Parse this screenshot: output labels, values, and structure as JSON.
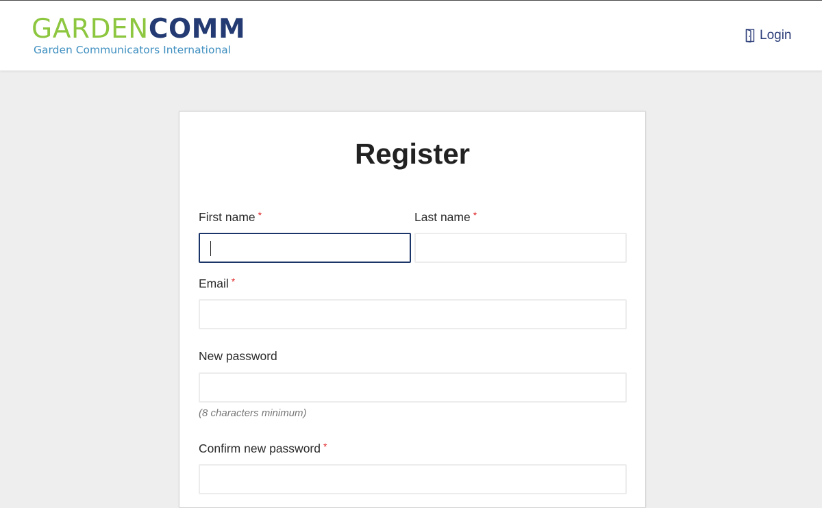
{
  "header": {
    "logo": {
      "brand_part1": "GARDEN",
      "brand_part2": "COMM",
      "tagline": "Garden Communicators International",
      "colors": {
        "garden": "#8dc63f",
        "comm": "#233a72",
        "tagline": "#3f8fc0"
      }
    },
    "login": {
      "icon": "door-icon",
      "label": "Login"
    }
  },
  "form": {
    "title": "Register",
    "required_marker": "*",
    "first_name": {
      "label": "First name",
      "value": "",
      "required": true,
      "focused": true
    },
    "last_name": {
      "label": "Last name",
      "value": "",
      "required": true
    },
    "email": {
      "label": "Email",
      "value": "",
      "required": true
    },
    "new_password": {
      "label": "New password",
      "value": "",
      "required": false,
      "hint": "(8 characters minimum)"
    },
    "confirm_password": {
      "label": "Confirm new password",
      "value": "",
      "required": true
    }
  },
  "colors": {
    "background": "#eeeeee",
    "focus_border": "#1c3568",
    "required": "#e0262a"
  }
}
